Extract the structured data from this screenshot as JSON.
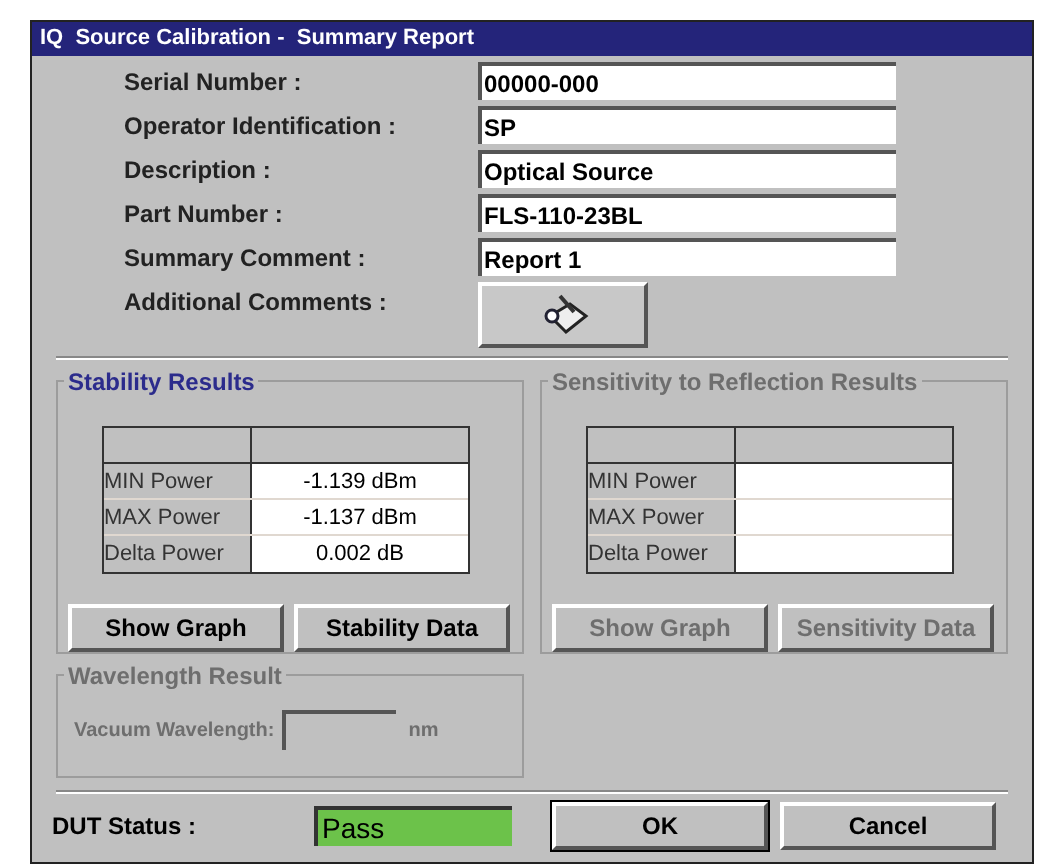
{
  "window": {
    "title": "IQ  Source Calibration -  Summary Report"
  },
  "fields": [
    {
      "label": "Serial Number :",
      "value": "00000-000"
    },
    {
      "label": "Operator Identification :",
      "value": "SP"
    },
    {
      "label": "Description :",
      "value": "Optical Source"
    },
    {
      "label": "Part Number :",
      "value": "FLS-110-23BL"
    },
    {
      "label": "Summary Comment :",
      "value": "Report 1"
    }
  ],
  "additional_comments": {
    "label": "Additional Comments :"
  },
  "groups": [
    {
      "title": "Stability Results",
      "disabled": false,
      "rows": [
        {
          "name": "MIN Power",
          "value": "-1.139 dBm"
        },
        {
          "name": "MAX Power",
          "value": "-1.137 dBm"
        },
        {
          "name": "Delta Power",
          "value": "0.002 dB"
        }
      ],
      "buttons": [
        "Show Graph",
        "Stability Data"
      ]
    },
    {
      "title": "Sensitivity to Reflection Results",
      "disabled": true,
      "rows": [
        {
          "name": "MIN Power"
        },
        {
          "name": "MAX Power"
        },
        {
          "name": "Delta Power"
        }
      ],
      "buttons": [
        "Show Graph",
        "Sensitivity Data"
      ]
    }
  ],
  "wavelength": {
    "title": "Wavelength Result",
    "disabled": true,
    "label": "Vacuum Wavelength:",
    "unit": "nm"
  },
  "dut_status": {
    "label": "DUT Status :",
    "value": "Pass",
    "passed": true
  },
  "buttons": [
    {
      "label": "OK",
      "default": true
    },
    {
      "label": "Cancel",
      "default": false
    }
  ]
}
